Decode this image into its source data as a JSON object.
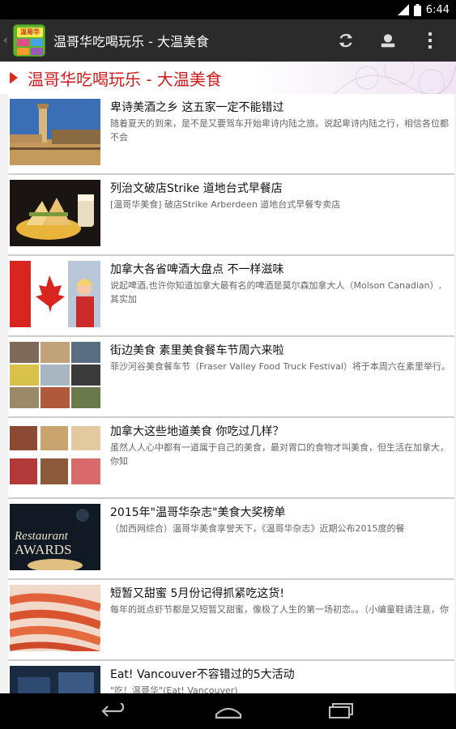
{
  "status_bar": {
    "time": "6:44"
  },
  "app": {
    "title": "温哥华吃喝玩乐 - 大温美食",
    "logo_text": "温哥华"
  },
  "header": {
    "title": "温哥华吃喝玩乐 - 大温美食"
  },
  "icons": {
    "refresh": "refresh-icon",
    "account": "account-icon",
    "overflow": "overflow-menu-icon",
    "back": "back-icon",
    "home": "home-icon",
    "recents": "recent-apps-icon"
  },
  "colors": {
    "action_bar": "#2b2b2b",
    "header_title": "#d31b1b",
    "marker": "#d62b1f",
    "list_bg": "#f2f2f2"
  },
  "items": [
    {
      "title": "卑诗美酒之乡 这五家一定不能错过",
      "summary": "随着夏天的到来，是不是又要驾车开始卑诗内陆之旅。说起卑诗内陆之行，相信各位都不会"
    },
    {
      "title": "列治文破店Strike 道地台式早餐店",
      "summary": "[温哥华美食] 破店Strike Arberdeen 道地台式早餐专卖店"
    },
    {
      "title": "加拿大各省啤酒大盘点 不一样滋味",
      "summary": "说起啤酒,也许你知道加拿大最有名的啤酒是莫尔森加拿大人（Molson Canadian）,其实加"
    },
    {
      "title": "街边美食 素里美食餐车节周六来啦",
      "summary": "菲沙河谷美食餐车节（Fraser Valley Food Truck Festival）将于本周六在素里举行。"
    },
    {
      "title": "加拿大这些地道美食 你吃过几样？",
      "summary": "虽然人人心中都有一道属于自己的美食，最对胃口的食物才叫美食，但生活在加拿大，你知"
    },
    {
      "title": "2015年\"温哥华杂志\"美食大奖榜单",
      "summary": "（加西网综合）温哥华美食享誉天下，《温哥华杂志》近期公布2015度的餐"
    },
    {
      "title": "短暂又甜蜜 5月份记得抓紧吃这货!",
      "summary": "每年的斑点虾节都是又短暂又甜蜜，像极了人生的第一场初恋。。（小编童鞋请注意，你"
    },
    {
      "title": "Eat! Vancouver不容错过的5大活动",
      "summary": "\"吃！温哥华\"(Eat! Vancouver)"
    }
  ]
}
